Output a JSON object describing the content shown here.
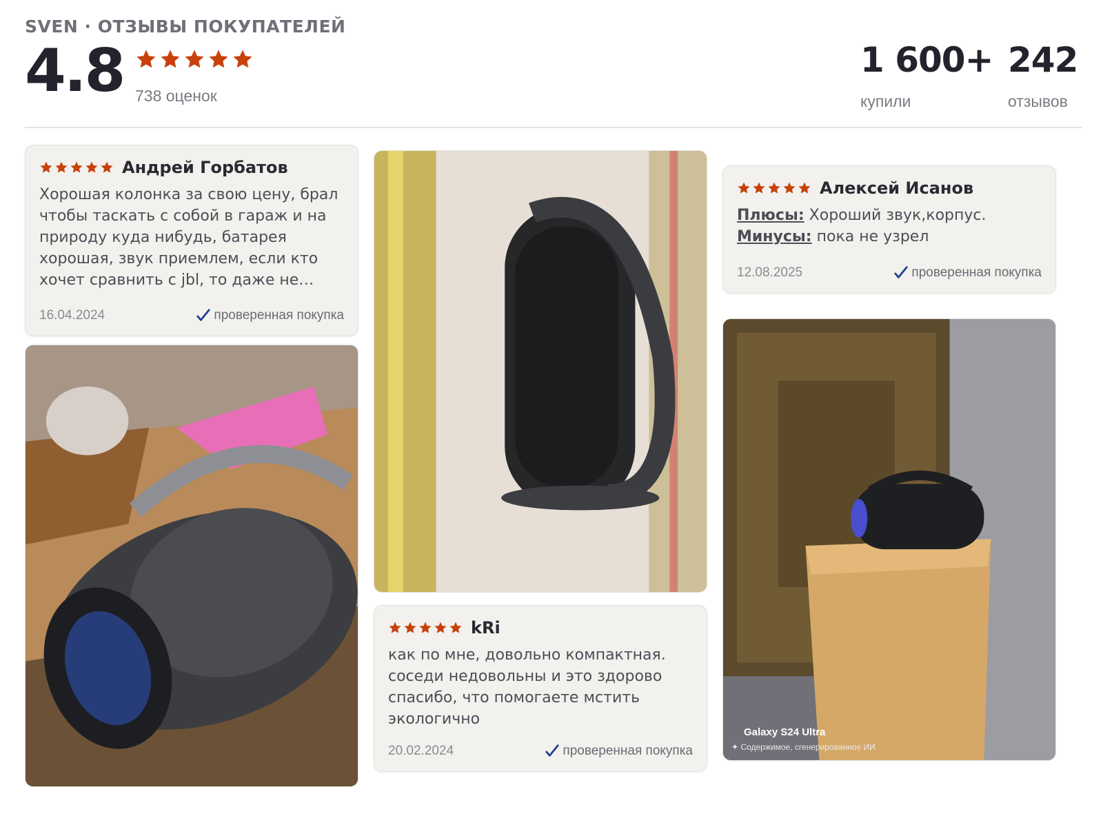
{
  "header": {
    "brand_line": "SVEN · ОТЗЫВЫ ПОКУПАТЕЛЕЙ",
    "rating": "4.8",
    "rating_count": "738 оценок",
    "bought_value": "1 600+",
    "bought_label": "купили",
    "reviews_value": "242",
    "reviews_label": "отзывов",
    "stars": 5
  },
  "colors": {
    "star": "#c8410b",
    "check": "#1f3d8c",
    "card_bg": "#f2f1ee"
  },
  "reviews": [
    {
      "author": "Андрей Горбатов",
      "stars": 5,
      "text": "Хорошая колонка за свою цену, брал чтобы таскать с собой в гараж и на природу куда нибудь, батарея хорошая, звук приемлем, если кто хочет сравнить с jbl, то даже не…",
      "date": "16.04.2024",
      "verified": "проверенная покупка"
    },
    {
      "author": "Алексей Исанов",
      "stars": 5,
      "pros_label": "Плюсы:",
      "pros": "Хороший звук,корпус.",
      "cons_label": "Минусы:",
      "cons": "пока не узрел",
      "date": "12.08.2025",
      "verified": "проверенная покупка"
    },
    {
      "author": "kRi",
      "stars": 5,
      "text": "как по мне, довольно компактная. соседи недовольны и это здорово спасибо, что помогаете мстить экологично",
      "date": "20.02.2024",
      "verified": "проверенная покупка"
    }
  ],
  "photo_captions": {
    "device": "Galaxy S24 Ultra",
    "ai_note": "Содержимое, сгенерированное ИИ"
  }
}
